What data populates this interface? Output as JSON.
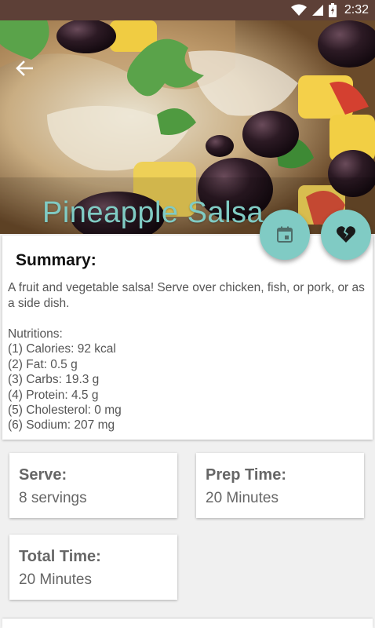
{
  "status_bar": {
    "time": "2:32"
  },
  "recipe": {
    "title": "Pineapple Salsa"
  },
  "summary": {
    "heading": "Summary:",
    "description": "A fruit and vegetable salsa! Serve over chicken, fish, or pork, or as a side dish.",
    "nutrition_heading": "Nutritions:",
    "nutrition_items": [
      "(1) Calories: 92 kcal",
      "(2) Fat: 0.5 g",
      "(3) Carbs: 19.3 g",
      "(4) Protein: 4.5 g",
      "(5) Cholesterol: 0 mg",
      "(6) Sodium: 207 mg"
    ]
  },
  "info_cards": {
    "serve": {
      "label": "Serve:",
      "value": "8 servings"
    },
    "prep": {
      "label": "Prep Time:",
      "value": "20 Minutes"
    },
    "total": {
      "label": "Total Time:",
      "value": "20 Minutes"
    }
  },
  "icons": {
    "back": "arrow-back-icon",
    "calendar": "calendar-icon",
    "favorite": "broken-heart-icon"
  },
  "colors": {
    "status_bar": "#5d4037",
    "accent": "#80cbc4",
    "background": "#f0f0f0"
  }
}
